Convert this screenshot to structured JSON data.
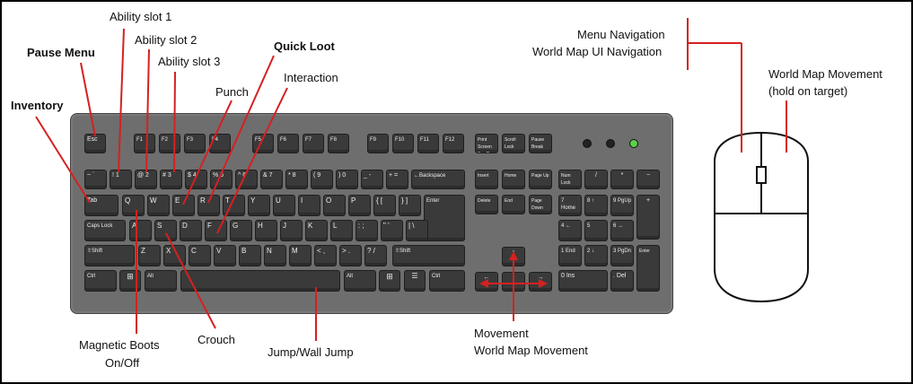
{
  "labels": {
    "ability1": "Ability slot 1",
    "ability2": "Ability slot 2",
    "ability3": "Ability slot 3",
    "pause": "Pause Menu",
    "quickloot": "Quick Loot",
    "interaction": "Interaction",
    "punch": "Punch",
    "inventory": "Inventory",
    "menu_nav": "Menu Navigation",
    "map_ui_nav": "World Map UI Navigation",
    "map_move_mouse_1": "World Map Movement",
    "map_move_mouse_2": "(hold on target)",
    "magnetic_1": "Magnetic Boots",
    "magnetic_2": "On/Off",
    "crouch": "Crouch",
    "jump": "Jump/Wall Jump",
    "movement": "Movement",
    "map_movement": "World Map Movement"
  },
  "colors": {
    "pointer": "#d62020",
    "key": "#3a3a3a",
    "board": "#6e6e6e"
  },
  "keys": {
    "esc": "Esc",
    "f": [
      "F1",
      "F2",
      "F3",
      "F4",
      "F5",
      "F6",
      "F7",
      "F8",
      "F9",
      "F10",
      "F11",
      "F12"
    ],
    "print": "Print Screen Sys Rq",
    "scroll": "Scroll Lock",
    "pause": "Pause Break",
    "num_row": [
      "~ `",
      "! 1",
      "@ 2",
      "# 3",
      "$ 4",
      "% 5",
      "^ 6",
      "& 7",
      "* 8",
      "( 9",
      ") 0",
      "_ -",
      "+ ="
    ],
    "backspace": "←Backspace",
    "tab": "Tab",
    "q_row": [
      "Q",
      "W",
      "E",
      "R",
      "T",
      "Y",
      "U",
      "I",
      "O",
      "P",
      "{ [",
      "} ]"
    ],
    "enter": "Enter",
    "caps": "Caps Lock",
    "a_row": [
      "A",
      "S",
      "D",
      "F",
      "G",
      "H",
      "J",
      "K",
      "L",
      ": ;",
      "\" '",
      "| \\"
    ],
    "shift": "⇧Shift",
    "z_row": [
      "Z",
      "X",
      "C",
      "V",
      "B",
      "N",
      "M",
      "< ,",
      "> .",
      "? /"
    ],
    "ctrl": "Ctrl",
    "alt": "Alt",
    "insert": "Insert",
    "home": "Home",
    "pageup": "Page Up",
    "delete": "Delete",
    "end": "End",
    "pagedown": "Page Down",
    "numlock": "Num Lock",
    "slash": "/",
    "star": "*",
    "minus": "−",
    "plus": "+",
    "np": [
      "7 Home",
      "8 ↑",
      "9 PgUp",
      "4 ←",
      "5",
      "6 →",
      "1 End",
      "2 ↓",
      "3 PgDn"
    ],
    "np0": "0 Ins",
    "npdot": ". Del",
    "npenter": "Enter",
    "arrows": [
      "↑",
      "←",
      "↓",
      "→"
    ]
  }
}
